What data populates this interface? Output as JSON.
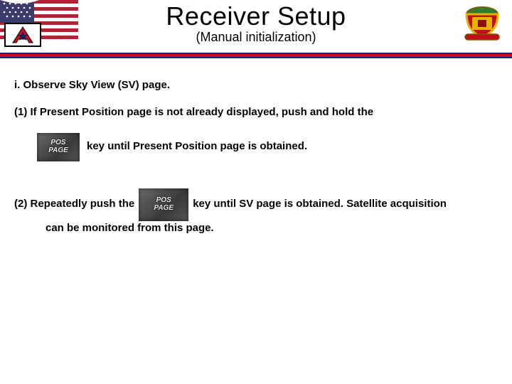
{
  "header": {
    "title": "Receiver Setup",
    "subtitle": "(Manual initialization)"
  },
  "body": {
    "section_i": "i. Observe Sky View (SV) page.",
    "step1_line1": "(1) If Present Position page is not already displayed, push and hold the",
    "step1_line2_after": "key until Present Position page is obtained.",
    "step2_before": "(2) Repeatedly push the",
    "step2_after": "key until SV page is obtained. Satellite acquisition",
    "step2_cont": "can be monitored from this page."
  },
  "keys": {
    "pos_page": "POS\nPAGE"
  },
  "icons": {
    "flag": "us-flag",
    "army_a": "letter-a-star",
    "crest": "unit-crest"
  },
  "colors": {
    "navy": "#1a2a6c",
    "red": "#c40f1a",
    "gold": "#e6b400",
    "green": "#2e7d32"
  }
}
